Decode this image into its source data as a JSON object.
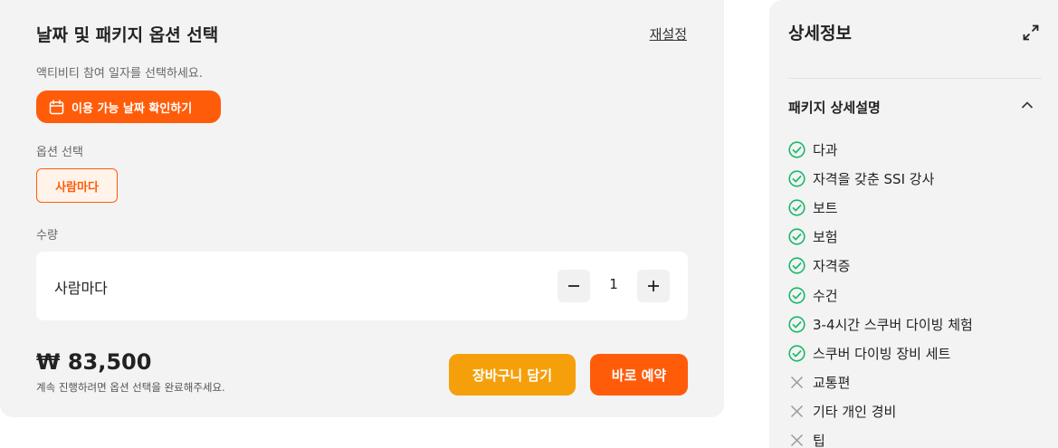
{
  "booking": {
    "title": "날짜 및 패키지 옵션 선택",
    "reset_label": "재설정",
    "subtitle": "액티비티 참여 일자를 선택하세요.",
    "date_button_label": "이용 가능 날짜 확인하기",
    "option_label": "옵션 선택",
    "selected_option": "사람마다",
    "quantity_label": "수량",
    "quantity_item": "사람마다",
    "quantity": "1",
    "price": "₩ 83,500",
    "price_note": "계속 진행하려면 옵션 선택을 완료해주세요.",
    "cart_button": "장바구니 담기",
    "book_button": "바로 예약",
    "accent_color": "#ff5c0a",
    "cart_color": "#f5a00b"
  },
  "details": {
    "title": "상세정보",
    "section_title": "패키지 상세설명",
    "included_color": "#19b86b",
    "items": [
      {
        "label": "다과",
        "included": true
      },
      {
        "label": "자격을 갖춘 SSI 강사",
        "included": true
      },
      {
        "label": "보트",
        "included": true
      },
      {
        "label": "보험",
        "included": true
      },
      {
        "label": "자격증",
        "included": true
      },
      {
        "label": "수건",
        "included": true
      },
      {
        "label": "3-4시간 스쿠버 다이빙 체험",
        "included": true
      },
      {
        "label": "스쿠버 다이빙 장비 세트",
        "included": true
      },
      {
        "label": "교통편",
        "included": false
      },
      {
        "label": "기타 개인 경비",
        "included": false
      },
      {
        "label": "팁",
        "included": false
      }
    ]
  }
}
